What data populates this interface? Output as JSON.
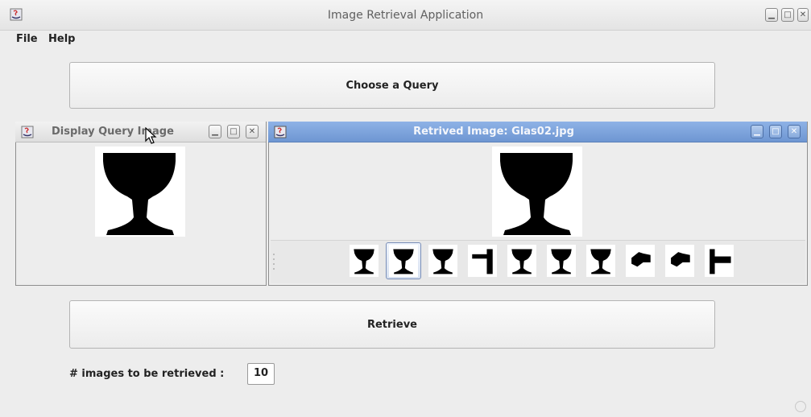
{
  "window": {
    "title": "Image Retrieval Application"
  },
  "menubar": {
    "items": [
      "File",
      "Help"
    ]
  },
  "query_button": {
    "label": "Choose a Query"
  },
  "query_frame": {
    "title": "Display Query Image"
  },
  "result_frame": {
    "title": "Retrived Image: Glas02.jpg",
    "selected_index": 1
  },
  "thumbnails": [
    {
      "shape": "glass"
    },
    {
      "shape": "glass"
    },
    {
      "shape": "glass"
    },
    {
      "shape": "hammer"
    },
    {
      "shape": "glass"
    },
    {
      "shape": "glass"
    },
    {
      "shape": "glass"
    },
    {
      "shape": "hammer-head"
    },
    {
      "shape": "hammer-head"
    },
    {
      "shape": "hammer-side"
    }
  ],
  "retrieve_button": {
    "label": "Retrieve"
  },
  "count": {
    "label": "# images to be retrieved :",
    "value": "10"
  },
  "colors": {
    "active_title": "#7aa0da",
    "inactive_title": "#e6e6e6"
  }
}
